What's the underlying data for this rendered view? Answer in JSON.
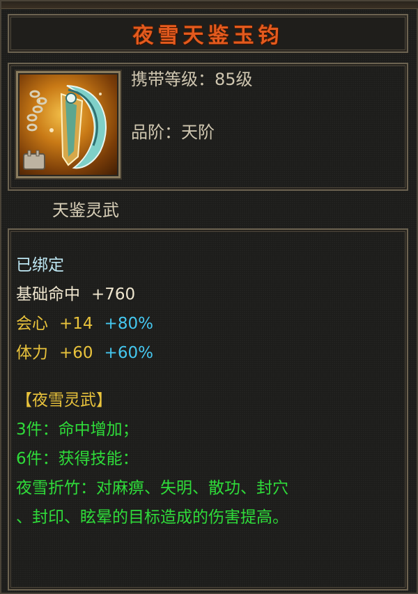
{
  "item": {
    "name": "夜雪天鉴玉钧",
    "carry_level_label": "携带等级：",
    "carry_level_value": "85级",
    "grade_label": "品阶：",
    "grade_value": "天阶",
    "set_title": "天鉴灵武",
    "icon": "jade-hook-weapon-icon"
  },
  "attributes": {
    "bound": "已绑定",
    "base": {
      "label": "基础命中",
      "value": "+760"
    },
    "crit": {
      "label": "会心",
      "value": "+14",
      "pct": "+80%"
    },
    "stamina": {
      "label": "体力",
      "value": "+60",
      "pct": "+60%"
    }
  },
  "set_bonus": {
    "name": "【夜雪灵武】",
    "piece3": "3件：命中增加；",
    "piece6": "6件：获得技能：",
    "skill_line1": "夜雪折竹：对麻痹、失明、散功、封穴",
    "skill_line2": "、封印、眩晕的目标造成的伤害提高。"
  },
  "colors": {
    "title": "#e35a1e",
    "bound": "#bde6f2",
    "gold": "#e9c33c",
    "cyan": "#45c8f0",
    "green": "#2fdc3a"
  }
}
